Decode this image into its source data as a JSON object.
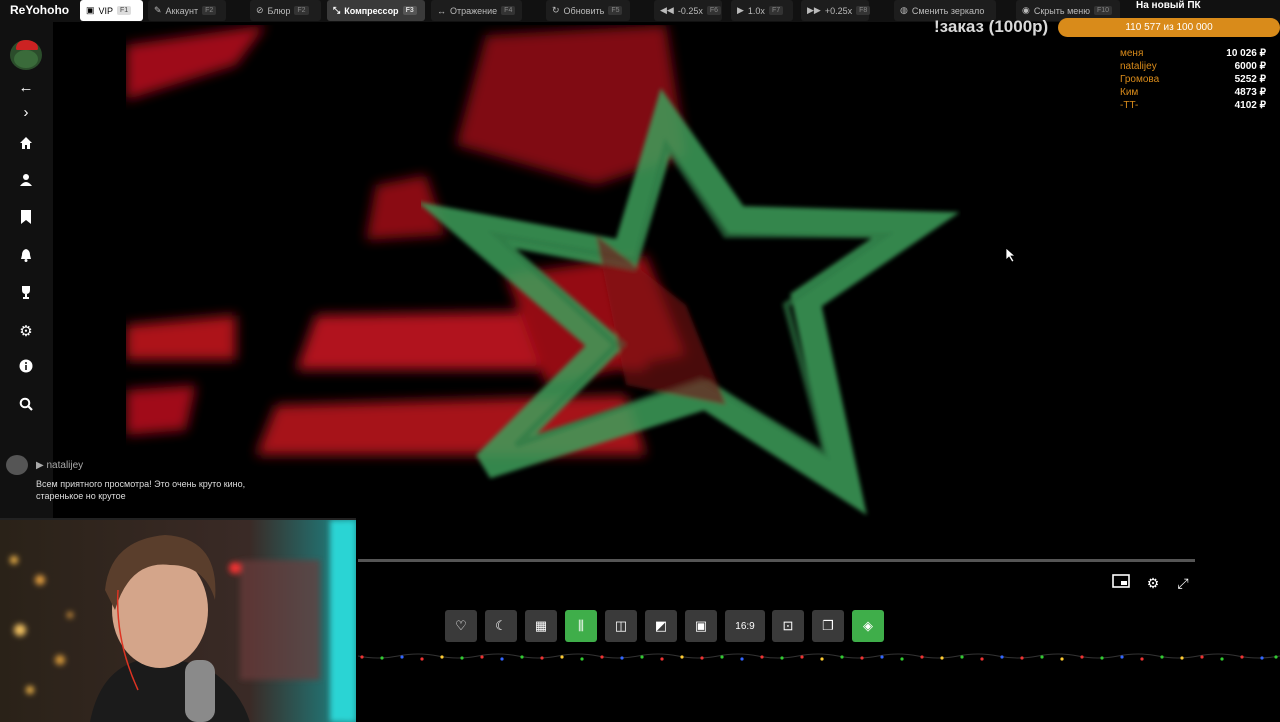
{
  "toolbar": {
    "brand": "ReYohoho",
    "buttons": [
      {
        "label": "VIP",
        "key": "F1",
        "icon": "vip-icon"
      },
      {
        "label": "Аккаунт",
        "key": "F2",
        "icon": "pen-icon"
      },
      {
        "label": "Блюр",
        "key": "F2",
        "icon": "blur-icon"
      },
      {
        "label": "Компрессор",
        "key": "F3",
        "icon": "compress-icon"
      },
      {
        "label": "Отражение",
        "key": "F4",
        "icon": "mirror-icon"
      },
      {
        "label": "Обновить",
        "key": "F5",
        "icon": "refresh-icon"
      },
      {
        "label": "-0.25x",
        "key": "F6",
        "icon": "rewind-icon"
      },
      {
        "label": "1.0x",
        "key": "F7",
        "icon": "play-icon"
      },
      {
        "label": "+0.25x",
        "key": "F8",
        "icon": "fast-forward-icon"
      },
      {
        "label": "Сменить зеркало",
        "key": "",
        "icon": "globe-icon"
      },
      {
        "label": "Скрыть меню",
        "key": "F10",
        "icon": "eye-icon"
      }
    ]
  },
  "goal": {
    "title": "На новый ПК",
    "order": "!заказ (1000р)",
    "progress": "110 577",
    "of": "из 100 000"
  },
  "donors": [
    {
      "name": "меня",
      "amount": "10 026 ₽"
    },
    {
      "name": "natalijey",
      "amount": "6000 ₽"
    },
    {
      "name": "Громова",
      "amount": "5252 ₽"
    },
    {
      "name": "Ким",
      "amount": "4873 ₽"
    },
    {
      "name": "-TT-",
      "amount": "4102 ₽"
    }
  ],
  "sidebar": {
    "icons": [
      "back-arrow-icon",
      "forward-arrow-icon",
      "home-icon",
      "user-icon",
      "bookmark-icon",
      "bell-icon",
      "trophy-icon",
      "gear-icon",
      "info-icon",
      "search-icon"
    ]
  },
  "chat": {
    "user": "natalijey",
    "message": "Всем приятного просмотра! Это очень круто кино, старенькое но крутое"
  },
  "player": {
    "aspect_label": "16:9",
    "buttons": [
      "heart-icon",
      "moon-icon",
      "grid-icon",
      "audio-wave-icon",
      "book-icon",
      "image-icon",
      "pip-icon",
      "aspect-ratio",
      "screenshot-icon",
      "copy-icon",
      "layers-icon"
    ]
  },
  "colors": {
    "accent": "#d98b1a",
    "green": "#3fae4a"
  }
}
